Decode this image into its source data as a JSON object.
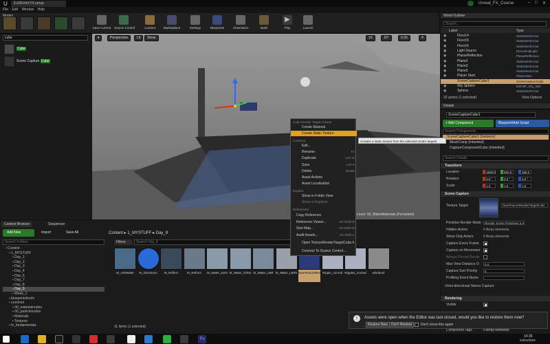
{
  "window": {
    "title": "Unreal_FX_Course",
    "tab": "Ex06Urbit FX.umap"
  },
  "menu": [
    "File",
    "Edit",
    "Window",
    "Help"
  ],
  "modes_label": "Modes",
  "place": {
    "search": "cube",
    "items": [
      {
        "label_pre": "",
        "label_hl": "Cube"
      },
      {
        "label_pre": "Scene Capture ",
        "label_hl": "Cube"
      }
    ]
  },
  "toolbar": [
    "Save Current",
    "Source Control",
    "Content",
    "Marketplace",
    "Settings",
    "Blueprints",
    "Cinematics",
    "Build",
    "Play",
    "Launch"
  ],
  "viewport": {
    "perspective": "Perspective",
    "lit": "Lit",
    "show": "Show",
    "level_label": "Level: 00_WaterMaterials (Persistent)",
    "grid": "10",
    "angle": "10°",
    "scale": "0.25",
    "cam": "4"
  },
  "outliner": {
    "title": "World Outliner",
    "search_placeholder": "Search...",
    "col_label": "Label",
    "col_type": "Type",
    "rows": [
      {
        "name": "Floor14",
        "type": "StaticMeshActor"
      },
      {
        "name": "Floor15",
        "type": "StaticMeshActor"
      },
      {
        "name": "Floor16",
        "type": "StaticMeshActor"
      },
      {
        "name": "Light Source",
        "type": "DirectionalLight"
      },
      {
        "name": "PlanarReflection",
        "type": "PlanarReflection"
      },
      {
        "name": "Plane2",
        "type": "StaticMeshActor"
      },
      {
        "name": "Plane3",
        "type": "StaticMeshActor"
      },
      {
        "name": "Plane5",
        "type": "StaticMeshActor"
      },
      {
        "name": "Player Start",
        "type": "PlayerStart"
      },
      {
        "name": "SceneCaptureCube1",
        "type": "SceneCaptureCube"
      },
      {
        "name": "Sky Sphere",
        "type": "Edit BP_Sky_Sph"
      },
      {
        "name": "Sphere",
        "type": "StaticMeshActor"
      }
    ],
    "count": "32 actors (1 selected)",
    "view_options": "View Options"
  },
  "details": {
    "title": "Details",
    "name": "SceneCaptureCube1",
    "add_component": "+ Add Component",
    "blueprint": "Blueprint/Add Script",
    "search_components": "Search Components",
    "components": [
      "SceneCaptureCube1 (Instance)",
      "MeshComp (Inherited)",
      "CaptureComponentCube (Inherited)"
    ],
    "search_details": "Search Details",
    "transform": "Transform",
    "location": "Location",
    "rotation": "Rotation",
    "scale": "Scale",
    "loc": [
      "1900.0",
      "920.0",
      "180.0"
    ],
    "rot": [
      "0.0 °",
      "0.0 °",
      "0.0 °"
    ],
    "scl": [
      "1.0",
      "1.0",
      "1.0"
    ],
    "scene_capture": "Scene Capture",
    "texture_target": "Texture Target",
    "texture_value": "NewTextureRenderTargetCube",
    "props": [
      {
        "label": "Primitive Render Mode",
        "value": "Render Scene Primitives (Legacy)"
      },
      {
        "label": "Hidden Actors",
        "value": "0 Array elements"
      },
      {
        "label": "Show Only Actors",
        "value": "0 Array elements"
      },
      {
        "label": "Capture Every Frame",
        "value": ""
      },
      {
        "label": "Capture on Movement",
        "value": ""
      },
      {
        "label": "Always Persist Rende",
        "value": ""
      },
      {
        "label": "Max View Distance O",
        "value": "0.0"
      },
      {
        "label": "Capture Sort Priority",
        "value": "0"
      },
      {
        "label": "Profiling Event Name",
        "value": ""
      }
    ],
    "omni": "Omni-directional Stereo Capture",
    "rendering": "Rendering",
    "visible": "Visible",
    "component_tags": "Component Tags",
    "component_tags_value": "0 Array elements"
  },
  "content_browser": {
    "tab1": "Content Browser",
    "tab2": "Sequencer",
    "add_new": "Add New",
    "import": "Import",
    "save_all": "Save All",
    "path": [
      "Content",
      "1_MYSTUFF",
      "Day_9"
    ],
    "search_folders": "Search Folders",
    "filters": "Filters",
    "search_assets": "Search Day_9",
    "tree": [
      "Content",
      "1_MYSTUFF",
      "Day_1",
      "Day_2",
      "Day_3",
      "Day_4",
      "Day_6",
      "Day_7",
      "Day_8",
      "Day_9",
      "Week_1",
      "blueprintsforvfx",
      "common",
      "00_materialnodes",
      "00_particlenodes",
      "Materials",
      "Textures",
      "fx_fundamentals"
    ],
    "assets": [
      "M_AdvWater",
      "M_Directions",
      "M_Reflect",
      "M_Refract",
      "M_Water_DZN",
      "M_Water_DZN1",
      "M_Water_LBR",
      "M_Water_LBR2",
      "NewTextureRenderTargetCube",
      "Ripple_normal",
      "Ripples_normal",
      "whirlpool"
    ],
    "count": "11 items (1 selected)"
  },
  "context_menu": {
    "header1": "Cube Render Target Actions",
    "create_material": "Create Material",
    "create_static": "Create Static Texture",
    "header2": "Common",
    "items": [
      {
        "label": "Edit...",
        "sc": ""
      },
      {
        "label": "Rename",
        "sc": "F2"
      },
      {
        "label": "Duplicate",
        "sc": "Ctrl+W"
      },
      {
        "label": "Save",
        "sc": "Ctrl+S"
      },
      {
        "label": "Delete",
        "sc": "Delete"
      },
      {
        "label": "Asset Actions",
        "sc": ""
      },
      {
        "label": "Asset Localization",
        "sc": ""
      }
    ],
    "header3": "Explore",
    "explore": [
      "Show in Folder View",
      "Show in Explorer"
    ],
    "header4": "References",
    "refs": [
      {
        "label": "Copy Reference",
        "sc": ""
      },
      {
        "label": "Reference Viewer...",
        "sc": "Alt+Shift+R"
      },
      {
        "label": "Size Map...",
        "sc": "Alt+Shift+M"
      },
      {
        "label": "Audit Assets...",
        "sc": "Alt+Shift+A"
      }
    ],
    "open": "Open TextureRenderTargetCube.h",
    "source": "Connect To Source Control..."
  },
  "tooltip": "Creates a static texture from the selected render targets.",
  "notification": {
    "text": "Assets were open when the Editor was last closed, would you like to restore them now?",
    "restore": "Restore Now",
    "dont": "Don't Restore",
    "dont_show": "Don't show this again"
  },
  "clock": {
    "time": "14:35",
    "date": "24/01/2019"
  }
}
